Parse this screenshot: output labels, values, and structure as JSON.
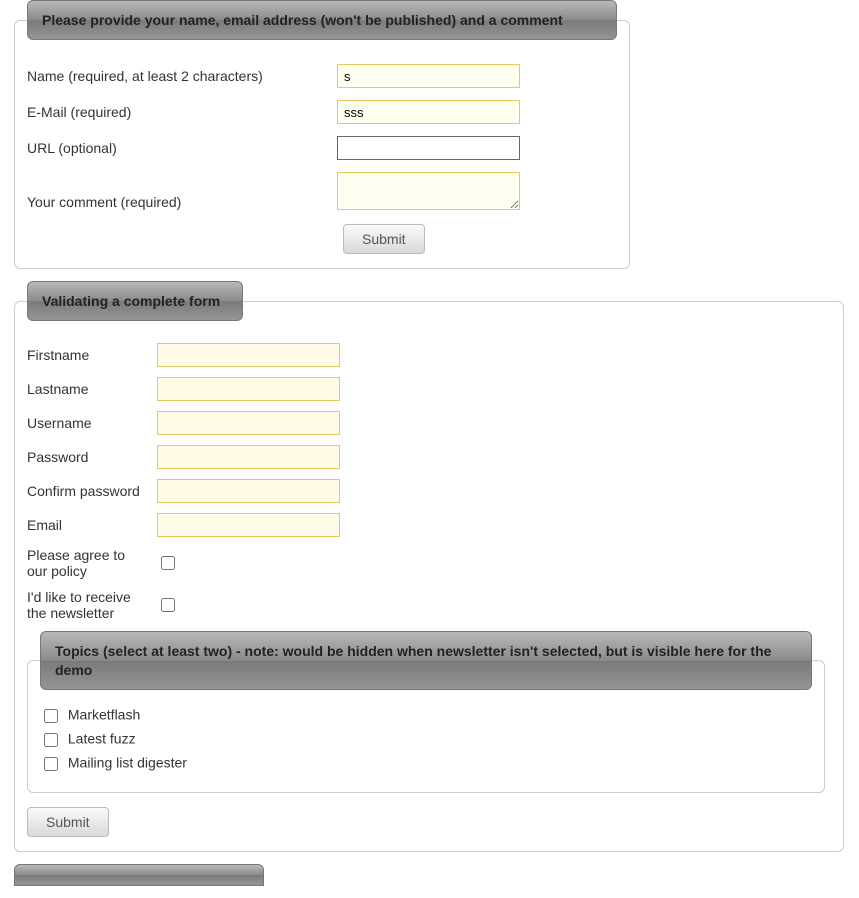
{
  "form1": {
    "legend": "Please provide your name, email address (won't be published) and a comment",
    "name_label": "Name (required, at least 2 characters)",
    "name_value": "s",
    "email_label": "E-Mail (required)",
    "email_value": "sss",
    "url_label": "URL (optional)",
    "url_value": "",
    "comment_label": "Your comment (required)",
    "comment_value": "",
    "submit_label": "Submit"
  },
  "form2": {
    "legend": "Validating a complete form",
    "firstname_label": "Firstname",
    "lastname_label": "Lastname",
    "username_label": "Username",
    "password_label": "Password",
    "confirm_label": "Confirm password",
    "email_label": "Email",
    "agree_label": "Please agree to our policy",
    "newsletter_label": "I'd like to receive the newsletter",
    "topics": {
      "legend": "Topics (select at least two) - note: would be hidden when newsletter isn't selected, but is visible here for the demo",
      "items": [
        "Marketflash",
        "Latest fuzz",
        "Mailing list digester"
      ]
    },
    "submit_label": "Submit"
  }
}
